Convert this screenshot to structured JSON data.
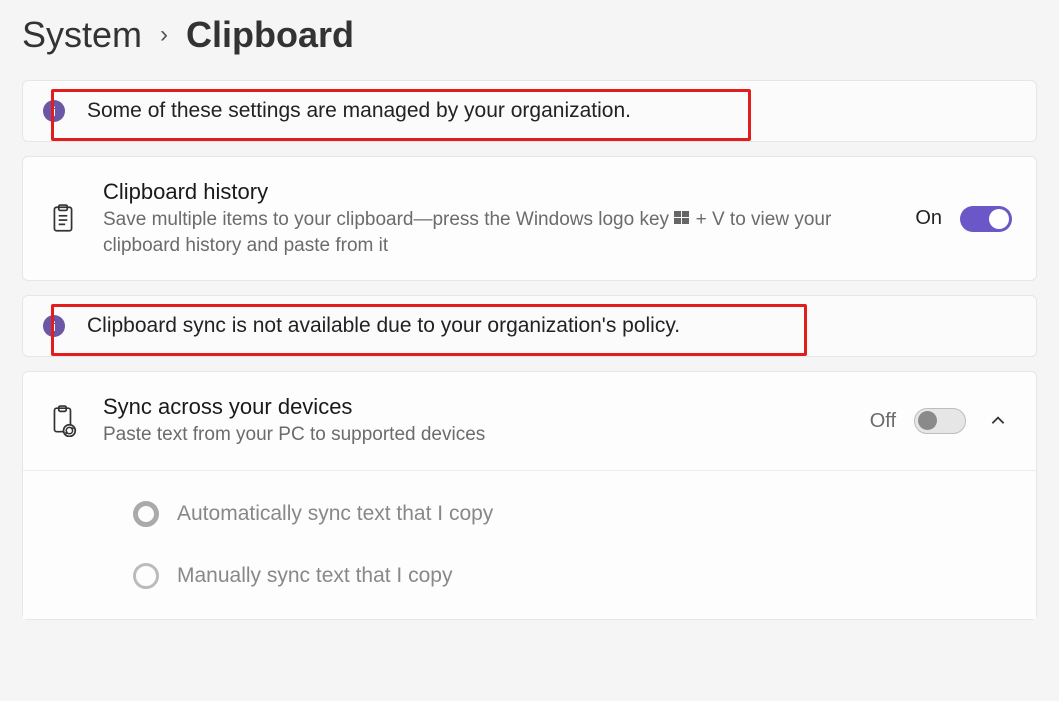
{
  "breadcrumb": {
    "parent": "System",
    "current": "Clipboard"
  },
  "banner_org": {
    "message": "Some of these settings are managed by your organization."
  },
  "history": {
    "title": "Clipboard history",
    "desc_before": "Save multiple items to your clipboard—press the Windows logo key ",
    "desc_after": " + V to view your clipboard history and paste from it",
    "state": "On"
  },
  "banner_sync": {
    "message": "Clipboard sync is not available due to your organization's policy."
  },
  "sync": {
    "title": "Sync across your devices",
    "desc": "Paste text from your PC to supported devices",
    "state": "Off",
    "options": {
      "auto": "Automatically sync text that I copy",
      "manual": "Manually sync text that I copy"
    }
  }
}
